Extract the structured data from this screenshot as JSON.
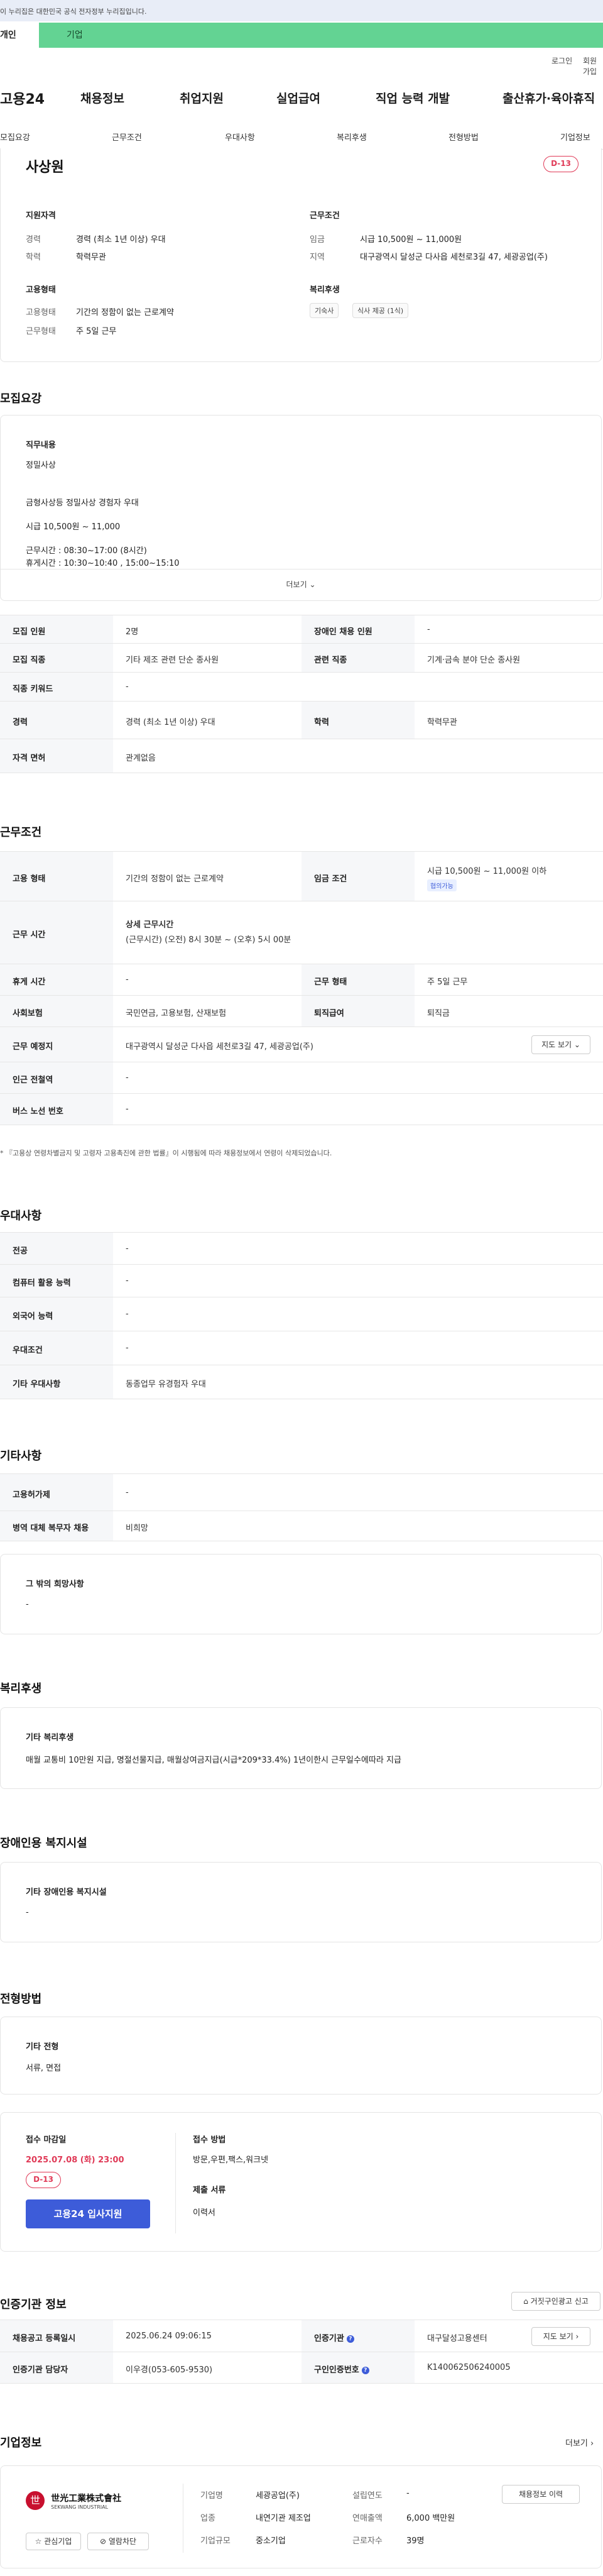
{
  "gov_banner": "이 누리집은 대한민국 공식 전자정부 누리집입니다.",
  "tabs": {
    "person": "개인",
    "company": "기업"
  },
  "util": {
    "login": "로그인",
    "signup": "회원가입"
  },
  "logo": "고용24",
  "gnb": [
    "채용정보",
    "취업지원",
    "실업급여",
    "직업 능력 개발",
    "출산휴가·육아휴직"
  ],
  "subnav": [
    "모집요강",
    "근무조건",
    "우대사항",
    "복리후생",
    "전형방법",
    "기업정보"
  ],
  "job": {
    "title": "사상원",
    "dday": "D-13",
    "qual_h": "지원자격",
    "career_l": "경력",
    "career_v": "경력 (최소 1년 이상) 우대",
    "edu_l": "학력",
    "edu_v": "학력무관",
    "cond_h": "근무조건",
    "wage_l": "임금",
    "wage_v": "시급 10,500원 ~ 11,000원",
    "region_l": "지역",
    "region_v": "대구광역시 달성군 다사읍 세천로3길 47, 세광공업(주)",
    "type_h": "고용형태",
    "emptype_l": "고용형태",
    "emptype_v": "기간의 정함이 없는 근로계약",
    "workform_l": "근무형태",
    "workform_v": "주 5일 근무",
    "welfare_h": "복리후생",
    "welfare_chips": [
      "기숙사",
      "식사 제공 (1식)"
    ]
  },
  "recruit": {
    "section": "모집요강",
    "desc_h": "직무내용",
    "desc_lines": [
      "정밀사상",
      "",
      "금형사상등 정밀사상 경험자 우대",
      "",
      "시급 10,500원 ~ 11,000",
      "",
      "근무시간 : 08:30~17:00 (8시간)",
      "휴게시간 : 10:30~10:40 , 15:00~15:10"
    ],
    "more": "더보기",
    "rows": [
      {
        "k1": "모집 인원",
        "v1": "2명",
        "k2": "장애인 채용 인원",
        "v2": "-"
      },
      {
        "k1": "모집 직종",
        "v1": "기타 제조 관련 단순 종사원",
        "k2": "관련 직종",
        "v2": "기계·금속 분야 단순 종사원"
      },
      {
        "k1": "직종 키워드",
        "v1": "-",
        "k2": "",
        "v2": ""
      },
      {
        "k1": "경력",
        "v1": "경력 (최소 1년 이상) 우대",
        "k2": "학력",
        "v2": "학력무관"
      },
      {
        "k1": "자격 면허",
        "v1": "관계없음",
        "k2": "",
        "v2": ""
      }
    ]
  },
  "condition": {
    "section": "근무조건",
    "emptype_k": "고용 형태",
    "emptype_v": "기간의 정함이 없는 근로계약",
    "wage_k": "임금 조건",
    "wage_v": "시급 10,500원 ~ 11,000원 이하",
    "wage_tag": "협의가능",
    "hours_k": "근무 시간",
    "hours_h": "상세 근무시간",
    "hours_v": "(근무시간) (오전) 8시 30분 ~ (오후) 5시 00분",
    "rest_k": "휴게 시간",
    "rest_v": "-",
    "form_k": "근무 형태",
    "form_v": "주 5일 근무",
    "ins_k": "사회보험",
    "ins_v": "국민연금, 고용보험, 산재보험",
    "sev_k": "퇴직급여",
    "sev_v": "퇴직금",
    "place_k": "근무 예정지",
    "place_v": "대구광역시 달성군 다사읍 세천로3길 47, 세광공업(주)",
    "map_btn": "지도 보기",
    "subway_k": "인근 전철역",
    "subway_v": "-",
    "bus_k": "버스 노선 번호",
    "bus_v": "-",
    "note": "* 『고용상 연령차별금지 및 고령자 고용촉진에 관한 법률』이 시행됨에 따라 채용정보에서 연령이 삭제되었습니다."
  },
  "prefer": {
    "section": "우대사항",
    "rows": [
      {
        "k": "전공",
        "v": "-"
      },
      {
        "k": "컴퓨터 활용 능력",
        "v": "-"
      },
      {
        "k": "외국어 능력",
        "v": "-"
      },
      {
        "k": "우대조건",
        "v": "-"
      },
      {
        "k": "기타 우대사항",
        "v": "동종업무 유경험자 우대"
      }
    ]
  },
  "other": {
    "section": "기타사항",
    "rows": [
      {
        "k": "고용허가제",
        "v": "-"
      },
      {
        "k": "병역 대체 복무자 채용",
        "v": "비희망"
      }
    ],
    "wish_h": "그 밖의 희망사항",
    "wish_v": "-"
  },
  "welfare": {
    "section": "복리후생",
    "h": "기타 복리후생",
    "v": "매월 교통비 10만원 지급, 명절선물지급, 매월상여금지급(시급*209*33.4%) 1년이한시 근무일수에따라 지급"
  },
  "disabled": {
    "section": "장애인용 복지시설",
    "h": "기타 장애인용 복지시설",
    "v": "-"
  },
  "selection": {
    "section": "전형방법",
    "h": "기타 전형",
    "v": "서류, 면접"
  },
  "apply": {
    "deadline_h": "접수 마감일",
    "deadline_v": "2025.07.08 (화) 23:00",
    "dday": "D-13",
    "btn": "고용24 입사지원",
    "method_h": "접수 방법",
    "method_v": "방문,우편,팩스,워크넷",
    "docs_h": "제출 서류",
    "docs_v": "이력서"
  },
  "cert": {
    "section": "인증기관 정보",
    "report_btn": "거짓구인광고 신고",
    "reg_k": "채용공고 등록일시",
    "reg_v": "2025.06.24 09:06:15",
    "agency_k": "인증기관",
    "agency_v": "대구달성고용센터",
    "map_btn": "지도 보기",
    "manager_k": "인증기관 담당자",
    "manager_v": "이우경(053-605-9530)",
    "id_k": "구인인증번호",
    "id_v": "K140062506240005"
  },
  "company": {
    "section": "기업정보",
    "more": "더보기",
    "logo_main": "世光工業株式會社",
    "logo_sub": "SEKWANG INDUSTRIAL",
    "name_k": "기업명",
    "name_v": "세광공업(주)",
    "found_k": "설립연도",
    "found_v": "-",
    "ind_k": "업종",
    "ind_v": "내연기관 제조업",
    "sales_k": "연매출액",
    "sales_v": "6,000 백만원",
    "size_k": "기업규모",
    "size_v": "중소기업",
    "emp_k": "근로자수",
    "emp_v": "39명",
    "jobs_btn": "채용정보 이력",
    "fav_btn": "관심기업",
    "block_btn": "열람차단"
  }
}
